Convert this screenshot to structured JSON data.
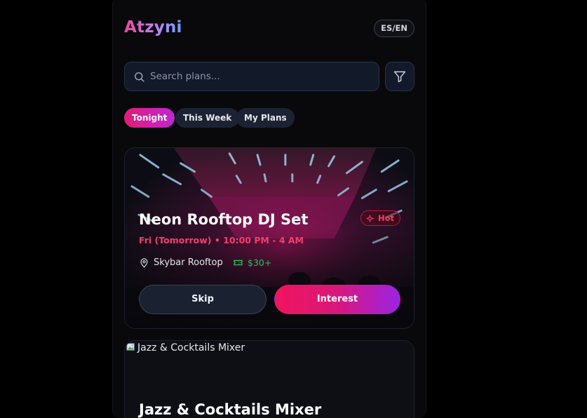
{
  "app": {
    "logo": "Atzyni",
    "language_toggle": "ES/EN"
  },
  "search": {
    "placeholder": "Search plans...",
    "value": ""
  },
  "icons": {
    "search": "search-icon",
    "filter": "filter-icon",
    "hot": "sparkle-icon",
    "location": "map-pin-icon",
    "price": "ticket-icon",
    "broken_image": "broken-image-icon"
  },
  "tabs": [
    {
      "label": "Tonight",
      "active": true
    },
    {
      "label": "This Week",
      "active": false
    },
    {
      "label": "My Plans",
      "active": false
    }
  ],
  "events": [
    {
      "title": "Neon Rooftop DJ Set",
      "badge": "Hot",
      "datetime": "Fri (Tomorrow) • 10:00 PM - 4 AM",
      "venue": "Skybar Rooftop",
      "price": "$30+",
      "skip_label": "Skip",
      "interest_label": "Interest"
    },
    {
      "title": "Jazz & Cocktails Mixer",
      "image_alt": "Jazz & Cocktails Mixer"
    }
  ],
  "colors": {
    "background": "#000000",
    "panel": "#09090c",
    "accent_pink": "#f0145c",
    "accent_purple": "#9b23e4",
    "hot": "#f43f5e",
    "price": "#22c55e",
    "time": "#f43f6e"
  }
}
